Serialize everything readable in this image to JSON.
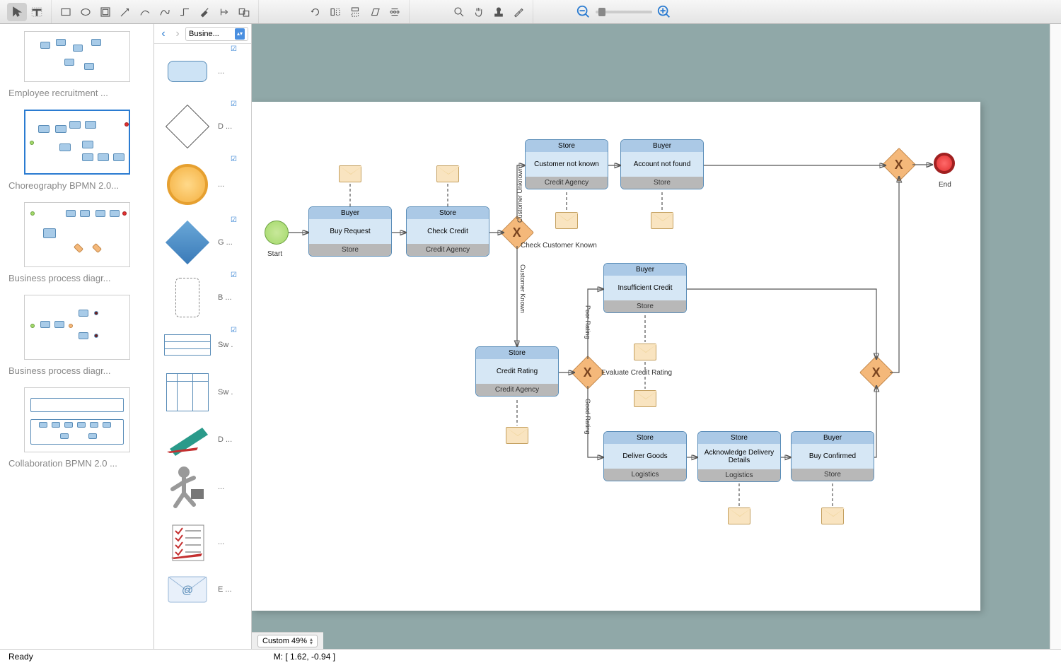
{
  "toolbar": {
    "tools": [
      "pointer",
      "text",
      "rect",
      "ellipse",
      "container",
      "arrow",
      "pen",
      "curve",
      "connector",
      "brush",
      "anchor",
      "group"
    ],
    "transform_tools": [
      "rotate",
      "flip-h",
      "flip-v",
      "shear",
      "distribute"
    ],
    "view_tools": [
      "zoom",
      "pan",
      "stamp",
      "eyedropper"
    ]
  },
  "thumbs": {
    "items": [
      {
        "label": "Employee recruitment ..."
      },
      {
        "label": "Choreography BPMN 2.0..."
      },
      {
        "label": "Business process diagr..."
      },
      {
        "label": "Business process diagr..."
      },
      {
        "label": "Collaboration BPMN 2.0 ..."
      }
    ]
  },
  "shapes": {
    "category": "Busine...",
    "items": [
      {
        "label": "...",
        "checked": true
      },
      {
        "label": "D ...",
        "checked": true
      },
      {
        "label": "...",
        "checked": true
      },
      {
        "label": "G ...",
        "checked": true
      },
      {
        "label": "B ...",
        "checked": true
      },
      {
        "label": "Sw .",
        "checked": true
      },
      {
        "label": "Sw .",
        "checked": false
      },
      {
        "label": "D ...",
        "checked": false
      },
      {
        "label": "...",
        "checked": false
      },
      {
        "label": "...",
        "checked": false
      },
      {
        "label": "E ...",
        "checked": false
      }
    ]
  },
  "diagram": {
    "start": "Start",
    "end": "End",
    "tasks": {
      "buy_request": {
        "top": "Buyer",
        "body": "Buy Request",
        "bottom": "Store"
      },
      "check_credit": {
        "top": "Store",
        "body": "Check Credit",
        "bottom": "Credit Agency"
      },
      "customer_not_known": {
        "top": "Store",
        "body": "Customer not known",
        "bottom": "Credit Agency"
      },
      "account_not_found": {
        "top": "Buyer",
        "body": "Account not found",
        "bottom": "Store"
      },
      "credit_rating": {
        "top": "Store",
        "body": "Credit Rating",
        "bottom": "Credit Agency"
      },
      "insufficient_credit": {
        "top": "Buyer",
        "body": "Insufficient Credit",
        "bottom": "Store"
      },
      "deliver_goods": {
        "top": "Store",
        "body": "Deliver Goods",
        "bottom": "Logistics"
      },
      "ack_delivery": {
        "top": "Store",
        "body": "Acknowledge Delivery Details",
        "bottom": "Logistics"
      },
      "buy_confirmed": {
        "top": "Buyer",
        "body": "Buy Confirmed",
        "bottom": "Store"
      }
    },
    "gateways": {
      "check_customer": "Check Customer Known",
      "evaluate_credit": "Evaluate Credit Rating"
    },
    "edge_labels": {
      "unknown": "Customer Unknown",
      "known": "Customer Known",
      "poor": "Poor Rating",
      "good": "Good Rating"
    }
  },
  "zoom_display": "Custom 49%",
  "status": {
    "ready": "Ready",
    "mouse": "M: [ 1.62, -0.94 ]"
  }
}
